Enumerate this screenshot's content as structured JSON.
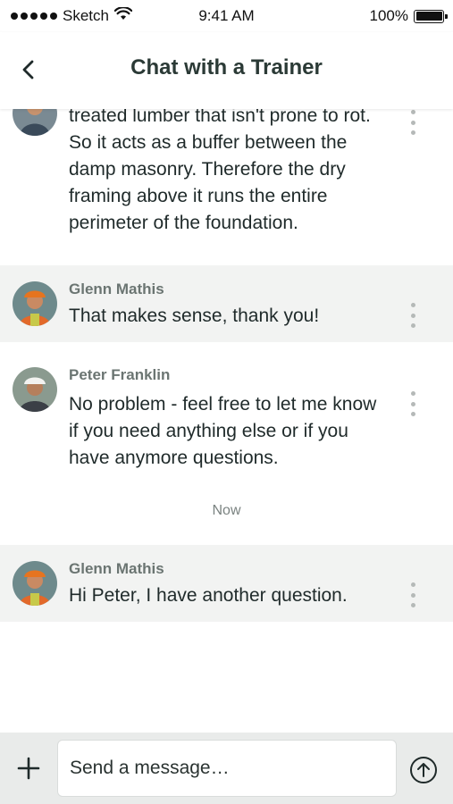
{
  "status_bar": {
    "carrier": "Sketch",
    "time": "9:41 AM",
    "battery": "100%",
    "battery_level": 1.0
  },
  "nav": {
    "title": "Chat with a Trainer",
    "back_icon": "chevron-left-icon"
  },
  "messages": [
    {
      "sender": "",
      "text": "treated lumber that isn't prone to rot. So it acts as a buffer between the damp masonry. Therefore the dry framing above it runs the entire perimeter of the foundation.",
      "shaded": false
    },
    {
      "sender": "Glenn Mathis",
      "text": "That makes sense, thank you!",
      "shaded": true
    },
    {
      "sender": "Peter Franklin",
      "text": "No problem - feel free to let me know if you need anything else or if you have anymore questions.",
      "shaded": false
    },
    {
      "sender": "Glenn Mathis",
      "text": "Hi Peter, I have another question.",
      "shaded": true
    }
  ],
  "timestamp": "Now",
  "composer": {
    "placeholder": "Send a message…",
    "add_icon": "plus-icon",
    "send_icon": "arrow-up-circle-icon"
  },
  "colors": {
    "title": "#2b3a36",
    "shaded_row": "#f2f3f2",
    "composer_bg": "#e9ebea",
    "sender": "#6b7572"
  }
}
